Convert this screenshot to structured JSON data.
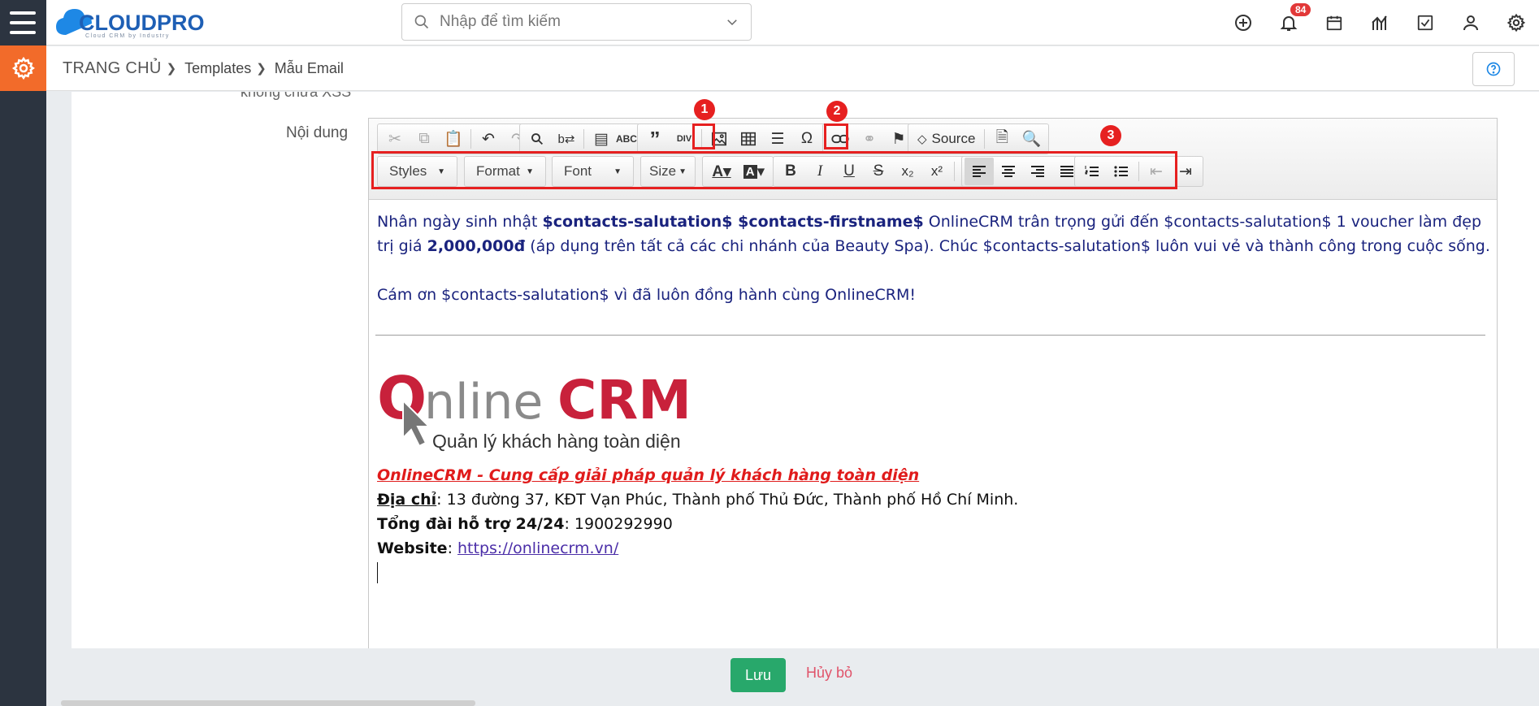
{
  "app": {
    "logo_text": "CLOUDPRO",
    "logo_tagline": "Cloud CRM by Industry"
  },
  "search": {
    "placeholder": "Nhập để tìm kiếm"
  },
  "header": {
    "notification_count": "84"
  },
  "breadcrumb": {
    "home": "TRANG CHỦ",
    "items": [
      "Templates",
      "Mẫu Email"
    ]
  },
  "form": {
    "cut_label": "không chứa XSS",
    "content_label": "Nội dung"
  },
  "toolbar": {
    "source_label": "Source",
    "styles_label": "Styles",
    "format_label": "Format",
    "font_label": "Font",
    "size_label": "Size"
  },
  "annotations": [
    "1",
    "2",
    "3"
  ],
  "content": {
    "p1_a": "Nhân ngày sinh nhật ",
    "p1_b": "$contacts-salutation$ $contacts-firstname$",
    "p1_c": " OnlineCRM trân trọng gửi đến $contacts-salutation$ 1 voucher làm đẹp trị giá ",
    "p1_d": "2,000,000đ",
    "p1_e": " (áp dụng trên tất cả các chi nhánh của Beauty Spa). Chúc $contacts-salutation$ luôn vui vẻ và thành công trong cuộc sống.",
    "p2": "Cám ơn $contacts-salutation$ vì đã luôn đồng hành cùng OnlineCRM!",
    "brand_name": "OnlineCRM",
    "brand_tagline": "Quản lý khách hàng toàn diện",
    "sig_title": "OnlineCRM - Cung cấp giải pháp quản lý khách hàng toàn diện",
    "addr_label": "Địa chỉ",
    "addr_value": ": 13 đường 37, KĐT Vạn Phúc, Thành phố Thủ Đức, Thành phố Hồ Chí Minh.",
    "hotline_label": "Tổng đài hỗ trợ 24/24",
    "hotline_value": ": 1900292990",
    "web_label": "Website",
    "web_sep": ": ",
    "web_url": "https://onlinecrm.vn/"
  },
  "actions": {
    "save": "Lưu",
    "cancel": "Hủy bỏ"
  },
  "colors": {
    "accent": "#f26b2a",
    "rail": "#2c3440",
    "save": "#28a86b",
    "annotation": "#e62020",
    "brand_red": "#c8213b",
    "brand_gray": "#8a8a8a"
  }
}
